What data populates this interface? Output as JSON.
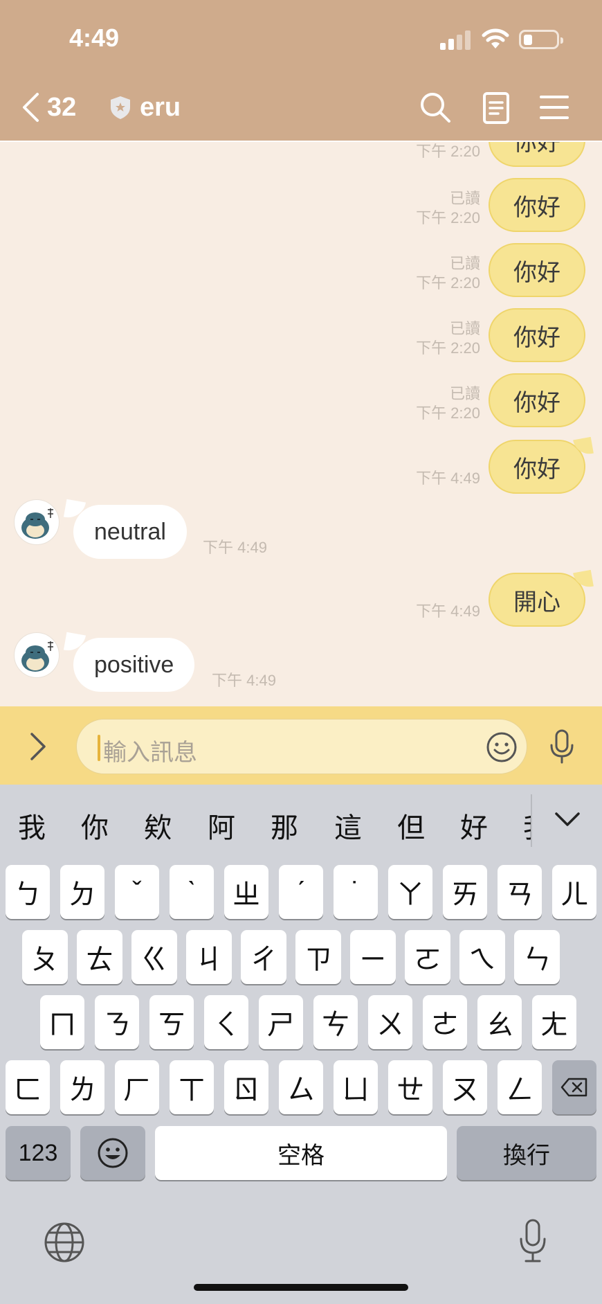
{
  "status": {
    "time": "4:49",
    "icons": [
      "signal-icon",
      "wifi-icon",
      "battery-icon"
    ]
  },
  "header": {
    "back_count": "32",
    "title": "eru",
    "icons": [
      "back-chevron-icon",
      "shield-icon",
      "search-icon",
      "notes-icon",
      "menu-icon"
    ]
  },
  "messages": [
    {
      "from": "me",
      "text": "你好",
      "read": "",
      "time": "下午 2:20"
    },
    {
      "from": "me",
      "text": "你好",
      "read": "已讀",
      "time": "下午 2:20"
    },
    {
      "from": "me",
      "text": "你好",
      "read": "已讀",
      "time": "下午 2:20"
    },
    {
      "from": "me",
      "text": "你好",
      "read": "已讀",
      "time": "下午 2:20"
    },
    {
      "from": "me",
      "text": "你好",
      "read": "已讀",
      "time": "下午 2:20"
    },
    {
      "from": "me",
      "text": "你好",
      "read": "",
      "time": "下午 4:49"
    },
    {
      "from": "bot",
      "text": "neutral",
      "time": "下午 4:49"
    },
    {
      "from": "me",
      "text": "開心",
      "read": "",
      "time": "下午 4:49"
    },
    {
      "from": "bot",
      "text": "positive",
      "time": "下午 4:49"
    }
  ],
  "input": {
    "placeholder": "輸入訊息"
  },
  "keyboard": {
    "candidates": [
      "我",
      "你",
      "欸",
      "阿",
      "那",
      "這",
      "但",
      "好",
      "我"
    ],
    "row1": [
      "ㄅ",
      "ㄉ",
      "ˇ",
      "ˋ",
      "ㄓ",
      "ˊ",
      "˙",
      "ㄚ",
      "ㄞ",
      "ㄢ",
      "ㄦ"
    ],
    "row2": [
      "ㄆ",
      "ㄊ",
      "ㄍ",
      "ㄐ",
      "ㄔ",
      "ㄗ",
      "ㄧ",
      "ㄛ",
      "ㄟ",
      "ㄣ"
    ],
    "row3": [
      "ㄇ",
      "ㄋ",
      "ㄎ",
      "ㄑ",
      "ㄕ",
      "ㄘ",
      "ㄨ",
      "ㄜ",
      "ㄠ",
      "ㄤ"
    ],
    "row4": [
      "ㄈ",
      "ㄌ",
      "ㄏ",
      "ㄒ",
      "ㄖ",
      "ㄙ",
      "ㄩ",
      "ㄝ",
      "ㄡ",
      "ㄥ"
    ],
    "numbers": "123",
    "space": "空格",
    "return": "換行"
  }
}
